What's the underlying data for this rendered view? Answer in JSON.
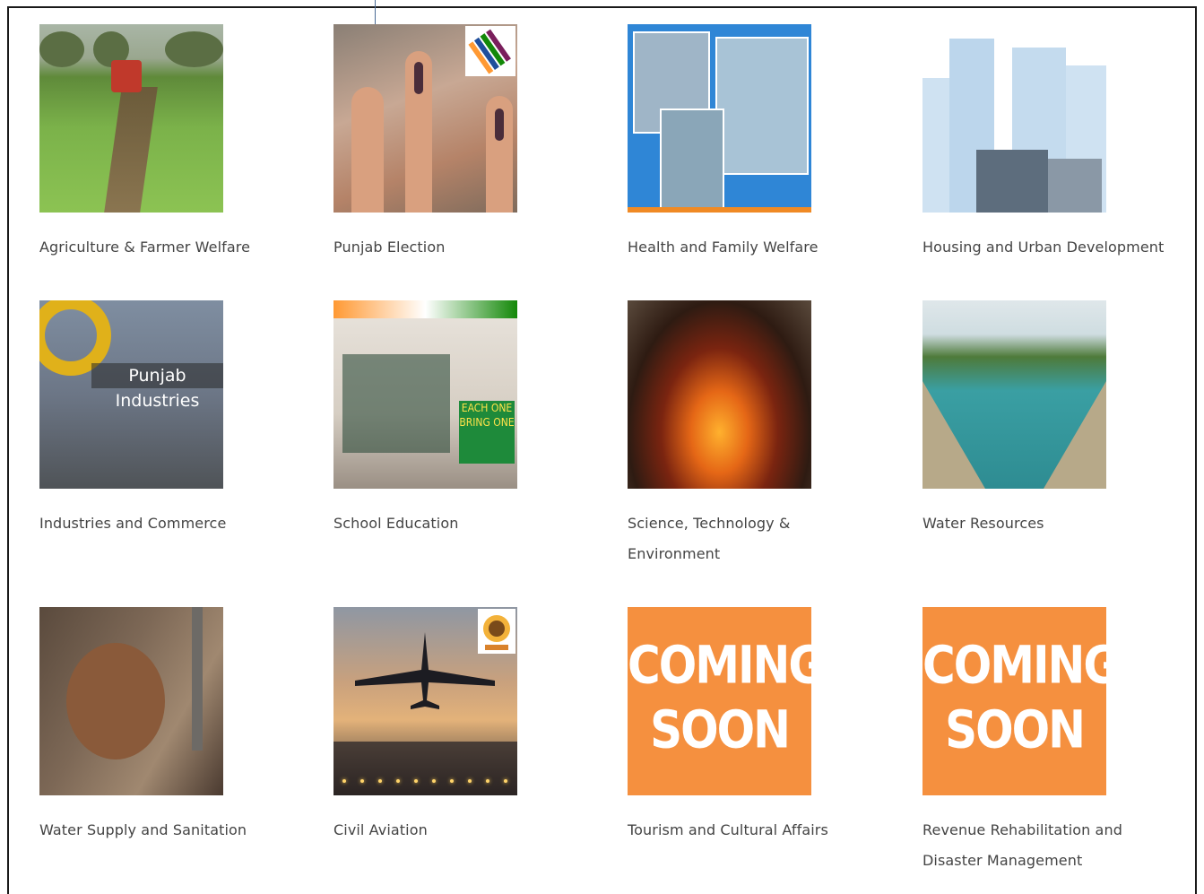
{
  "tiles": [
    {
      "label": "Agriculture & Farmer Welfare"
    },
    {
      "label": "Punjab Election"
    },
    {
      "label": "Health and Family Welfare"
    },
    {
      "label": "Housing and Urban Development"
    },
    {
      "label": "Industries and Commerce",
      "image_text": "Punjab Industries"
    },
    {
      "label": "School Education",
      "image_text": "EACH ONE BRING ONE"
    },
    {
      "label": "Science, Technology & Environment"
    },
    {
      "label": "Water Resources"
    },
    {
      "label": "Water Supply and Sanitation"
    },
    {
      "label": "Civil Aviation"
    },
    {
      "label": "Tourism and Cultural Affairs",
      "image_text": [
        "COMING",
        "SOON"
      ]
    },
    {
      "label": "Revenue Rehabilitation and Disaster Management",
      "image_text": [
        "COMING",
        "SOON"
      ]
    }
  ],
  "colors": {
    "label_text": "#444444",
    "coming_soon_bg": "#f5903f",
    "frame_border": "#1a1a1a"
  }
}
